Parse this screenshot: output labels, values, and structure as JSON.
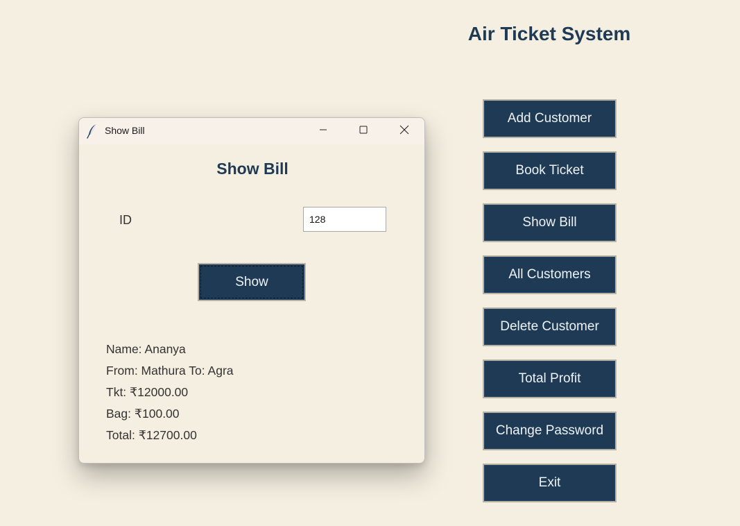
{
  "app": {
    "title": "Air Ticket System"
  },
  "menu": {
    "items": [
      {
        "label": "Add Customer"
      },
      {
        "label": "Book Ticket"
      },
      {
        "label": "Show Bill"
      },
      {
        "label": "All Customers"
      },
      {
        "label": "Delete Customer"
      },
      {
        "label": "Total Profit"
      },
      {
        "label": "Change Password"
      },
      {
        "label": "Exit"
      }
    ]
  },
  "dialog": {
    "window_title": "Show Bill",
    "heading": "Show Bill",
    "id_label": "ID",
    "id_value": "128",
    "show_button": "Show",
    "bill": {
      "name": "Name: Ananya",
      "route": "From: Mathura To: Agra",
      "ticket": "Tkt: ₹12000.00",
      "bag": "Bag: ₹100.00",
      "total": "Total: ₹12700.00"
    }
  },
  "icons": {
    "app_icon": "feather-icon",
    "minimize": "minimize-icon",
    "maximize": "maximize-icon",
    "close": "close-icon"
  },
  "colors": {
    "background": "#f5efe1",
    "accent": "#1e3a55",
    "button_text": "#eef2f5"
  }
}
